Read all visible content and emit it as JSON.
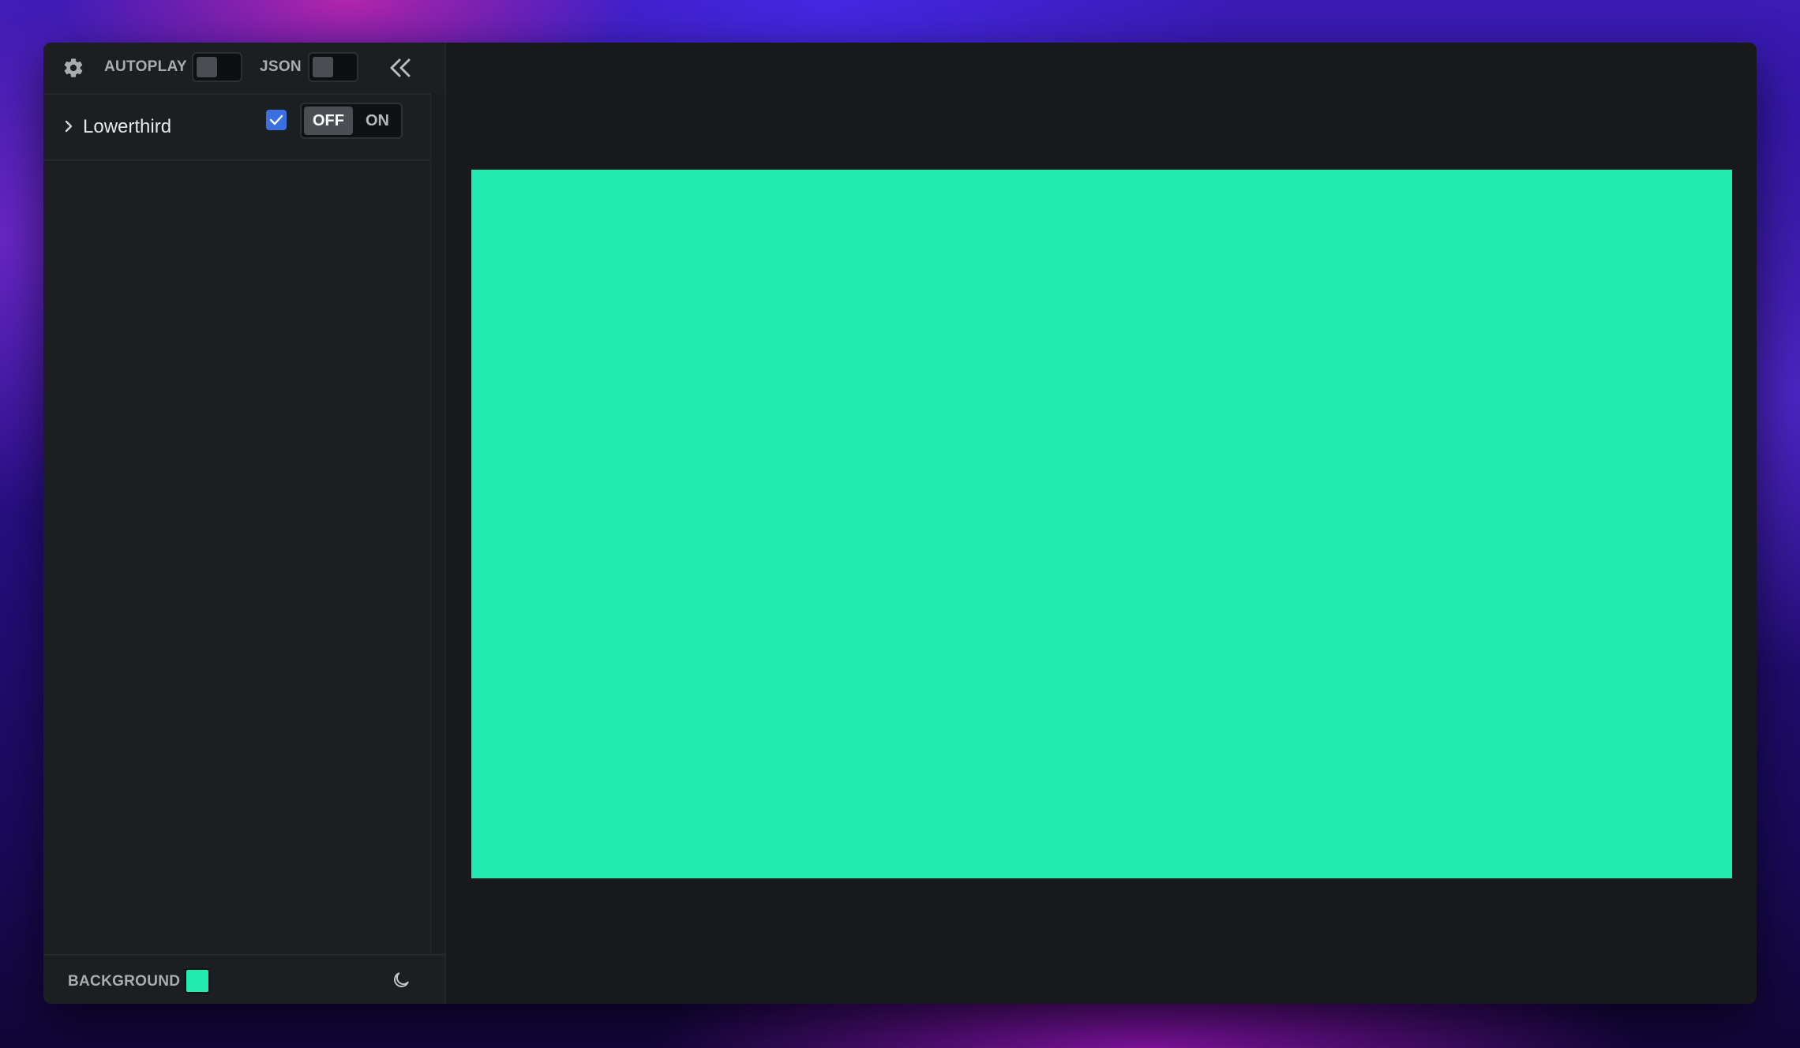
{
  "toolbar": {
    "settings_icon": "gear-icon",
    "autoplay_label": "AUTOPLAY",
    "autoplay_on": false,
    "json_label": "JSON",
    "json_on": false,
    "collapse_icon": "double-chevron-left-icon"
  },
  "components": [
    {
      "name": "Lowerthird",
      "expanded": false,
      "checked": true,
      "state_off_label": "OFF",
      "state_on_label": "ON",
      "state": "OFF"
    }
  ],
  "footer": {
    "background_label": "BACKGROUND",
    "background_color": "#22ecb0",
    "theme_icon": "moon-icon"
  },
  "preview": {
    "stage_color": "#22ecb0"
  }
}
